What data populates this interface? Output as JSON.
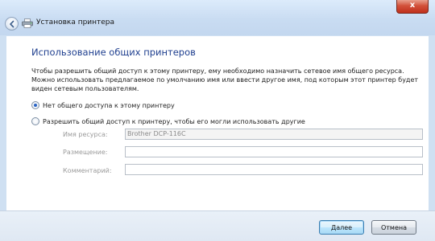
{
  "window": {
    "title": "Установка принтера",
    "close_glyph": "x",
    "colors": {
      "heading": "#1f3f8f",
      "close": "#c7402a",
      "glass": "#cfe0f2"
    }
  },
  "icons": [
    "back-arrow-icon",
    "printer-icon",
    "close-icon",
    "radio-icon"
  ],
  "main": {
    "heading": "Использование общих принтеров",
    "description": "Чтобы разрешить общий доступ к этому принтеру, ему необходимо назначить сетевое имя общего ресурса. Можно использовать предлагаемое по умолчанию имя или ввести другое имя, под которым этот принтер будет виден сетевым пользователям.",
    "options": [
      {
        "label": "Нет общего доступа к этому принтеру",
        "selected": true
      },
      {
        "label": "Разрешить общий доступ к принтеру, чтобы его могли использовать другие",
        "selected": false
      }
    ],
    "fields": {
      "share_name": {
        "label": "Имя ресурса:",
        "value": "Brother DCP-116C"
      },
      "location": {
        "label": "Размещение:",
        "value": ""
      },
      "comment": {
        "label": "Комментарий:",
        "value": ""
      }
    }
  },
  "footer": {
    "next_label": "Далее",
    "cancel_label": "Отмена"
  }
}
